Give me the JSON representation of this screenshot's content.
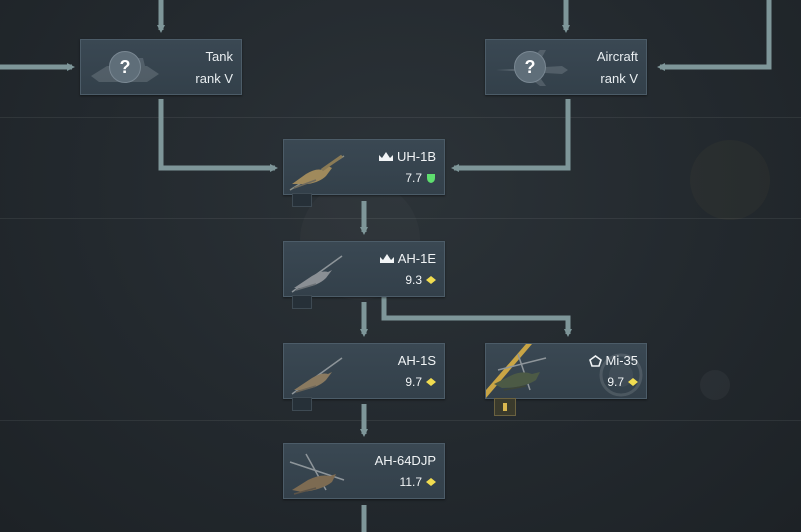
{
  "tree": {
    "rank_cards": [
      {
        "line1": "Tank",
        "line2": "rank V"
      },
      {
        "line1": "Aircraft",
        "line2": "rank V"
      }
    ],
    "rank_icon": "?",
    "vehicles": [
      {
        "name": "UH-1B",
        "br": "7.7",
        "prefix_icon": "crown-icon",
        "status_icon": "shield-icon"
      },
      {
        "name": "AH-1E",
        "br": "9.3",
        "prefix_icon": "crown-icon",
        "status_icon": "diamond-icon"
      },
      {
        "name": "AH-1S",
        "br": "9.7",
        "prefix_icon": "",
        "status_icon": "diamond-icon"
      },
      {
        "name": "Mi-35",
        "br": "9.7",
        "prefix_icon": "pentagon-icon",
        "status_icon": "diamond-icon"
      },
      {
        "name": "AH-64DJP",
        "br": "11.7",
        "prefix_icon": "",
        "status_icon": "diamond-icon"
      }
    ]
  },
  "colors": {
    "connector": "#7e9699",
    "shield": "#5ede6f",
    "diamond": "#f0dc50",
    "card_bg": "#36434d",
    "gold_stripe": "#c9a545"
  }
}
